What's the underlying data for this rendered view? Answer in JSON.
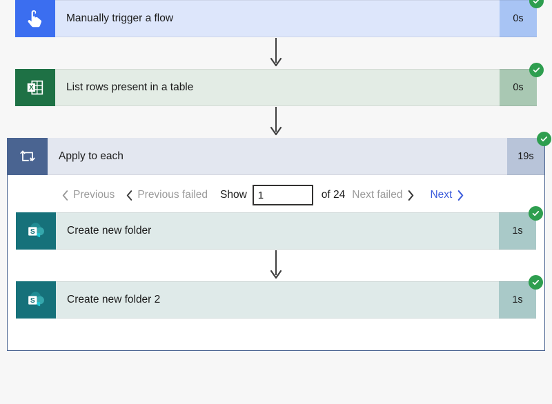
{
  "flow": {
    "steps": [
      {
        "id": "trigger",
        "label": "Manually trigger a flow",
        "duration": "0s",
        "icon": "tap-hand-icon",
        "status": "succeeded",
        "status_icon": "check-circle-icon"
      },
      {
        "id": "list-rows",
        "label": "List rows present in a table",
        "duration": "0s",
        "icon": "excel-icon",
        "status": "succeeded",
        "status_icon": "check-circle-icon"
      }
    ],
    "loop": {
      "label": "Apply to each",
      "duration": "19s",
      "icon": "loop-repeat-icon",
      "status": "succeeded",
      "status_icon": "check-circle-icon",
      "pager": {
        "previous_label": "Previous",
        "previous_icon": "chevron-left-icon",
        "previous_failed_label": "Previous failed",
        "previous_failed_icon": "chevron-left-icon",
        "show_label": "Show",
        "page_value": "1",
        "page_placeholder": "",
        "of_label": "of 24",
        "total_pages": 24,
        "next_failed_label": "Next failed",
        "next_failed_icon": "chevron-right-icon",
        "next_label": "Next",
        "next_icon": "chevron-right-icon"
      },
      "steps": [
        {
          "id": "create-folder-1",
          "label": "Create new folder",
          "duration": "1s",
          "icon": "sharepoint-icon",
          "status": "succeeded",
          "status_icon": "check-circle-icon"
        },
        {
          "id": "create-folder-2",
          "label": "Create new folder 2",
          "duration": "1s",
          "icon": "sharepoint-icon",
          "status": "succeeded",
          "status_icon": "check-circle-icon"
        }
      ]
    }
  },
  "colors": {
    "page_background": "#f7f7f7",
    "trigger_accent": "#3b6ef0",
    "excel_accent": "#1e7145",
    "sharepoint_accent": "#16717a",
    "loop_accent": "#4a6491",
    "success_green": "#2e9e4f",
    "link_blue": "#3b5bdb",
    "disabled_gray": "#9a9a9a",
    "connector_gray": "#3f3f3f"
  }
}
